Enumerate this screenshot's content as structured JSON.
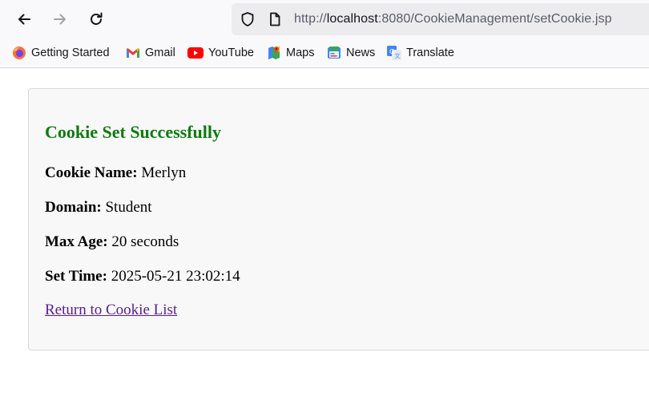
{
  "browser": {
    "url_protocol": "http://",
    "url_host": "localhost",
    "url_rest": ":8080/CookieManagement/setCookie.jsp"
  },
  "bookmarks": [
    {
      "label": "Getting Started",
      "icon": "firefox-icon"
    },
    {
      "label": "Gmail",
      "icon": "gmail-icon"
    },
    {
      "label": "YouTube",
      "icon": "youtube-icon"
    },
    {
      "label": "Maps",
      "icon": "maps-icon"
    },
    {
      "label": "News",
      "icon": "news-icon"
    },
    {
      "label": "Translate",
      "icon": "translate-icon"
    }
  ],
  "page": {
    "heading": "Cookie Set Successfully",
    "heading_color": "#0f7a0f",
    "fields": [
      {
        "label": "Cookie Name:",
        "value": "Merlyn"
      },
      {
        "label": "Domain:",
        "value": "Student"
      },
      {
        "label": "Max Age:",
        "value": "20 seconds"
      },
      {
        "label": "Set Time:",
        "value": "2025-05-21 23:02:14"
      }
    ],
    "return_link": "Return to Cookie List"
  }
}
